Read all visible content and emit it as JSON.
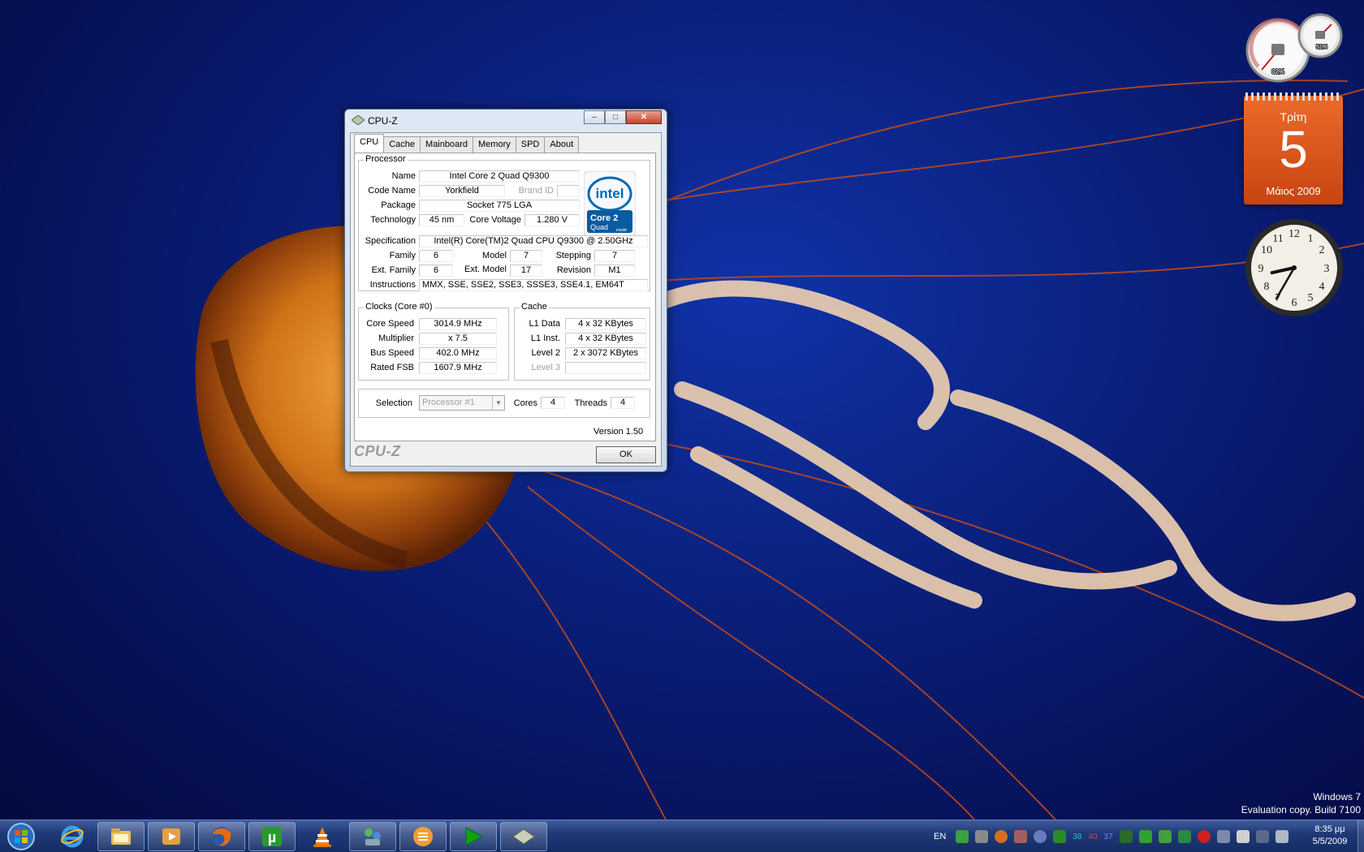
{
  "window": {
    "title": "CPU-Z",
    "tabs": [
      "CPU",
      "Cache",
      "Mainboard",
      "Memory",
      "SPD",
      "About"
    ],
    "active_tab": "CPU",
    "processor": {
      "group_label": "Processor",
      "name_label": "Name",
      "name": "Intel Core 2 Quad Q9300",
      "codename_label": "Code Name",
      "codename": "Yorkfield",
      "brandid_label": "Brand ID",
      "brandid": "",
      "package_label": "Package",
      "package": "Socket 775 LGA",
      "technology_label": "Technology",
      "technology": "45 nm",
      "voltage_label": "Core Voltage",
      "voltage": "1.280 V",
      "spec_label": "Specification",
      "spec": "Intel(R) Core(TM)2 Quad  CPU   Q9300  @ 2.50GHz",
      "family_label": "Family",
      "family": "6",
      "model_label": "Model",
      "model": "7",
      "stepping_label": "Stepping",
      "stepping": "7",
      "extfamily_label": "Ext. Family",
      "extfamily": "6",
      "extmodel_label": "Ext. Model",
      "extmodel": "17",
      "revision_label": "Revision",
      "revision": "M1",
      "instructions_label": "Instructions",
      "instructions": "MMX, SSE, SSE2, SSE3, SSSE3, SSE4.1, EM64T"
    },
    "logo": {
      "brand": "intel",
      "line1": "Core 2",
      "line2": "Quad",
      "line3": "inside"
    },
    "clocks": {
      "group_label": "Clocks (Core #0)",
      "core_speed_label": "Core Speed",
      "core_speed": "3014.9 MHz",
      "multiplier_label": "Multiplier",
      "multiplier": "x 7.5",
      "bus_speed_label": "Bus Speed",
      "bus_speed": "402.0 MHz",
      "rated_fsb_label": "Rated FSB",
      "rated_fsb": "1607.9 MHz"
    },
    "cache": {
      "group_label": "Cache",
      "l1data_label": "L1 Data",
      "l1data": "4 x 32 KBytes",
      "l1inst_label": "L1 Inst.",
      "l1inst": "4 x 32 KBytes",
      "level2_label": "Level 2",
      "level2": "2 x 3072 KBytes",
      "level3_label": "Level 3",
      "level3": ""
    },
    "selection": {
      "label": "Selection",
      "value": "Processor #1",
      "cores_label": "Cores",
      "cores": "4",
      "threads_label": "Threads",
      "threads": "4"
    },
    "version": "Version 1.50",
    "brand": "CPU-Z",
    "ok_label": "OK"
  },
  "gadgets": {
    "meter": {
      "cpu_usage": "02%",
      "memory_usage": "51%"
    },
    "calendar": {
      "day_name": "Τρίτη",
      "day_number": "5",
      "month_year": "Μάιος 2009"
    },
    "clock": {
      "hour": 8,
      "minute": 35
    }
  },
  "watermark": {
    "line1": "Windows 7",
    "line2": "Evaluation copy. Build 7100"
  },
  "taskbar": {
    "language": "EN",
    "tray_numbers": [
      "38",
      "40",
      "37"
    ],
    "time": "8:35 μμ",
    "date": "5/5/2009",
    "pinned": [
      "internet-explorer",
      "windows-explorer",
      "media-player",
      "firefox",
      "utorrent",
      "vlc",
      "network-app",
      "media-app",
      "play-app",
      "cpu-z"
    ]
  },
  "colors": {
    "desktop_blue": "#0a1f7a",
    "calendar_orange": "#e2561e",
    "window_frame": "#c9d7e8"
  }
}
